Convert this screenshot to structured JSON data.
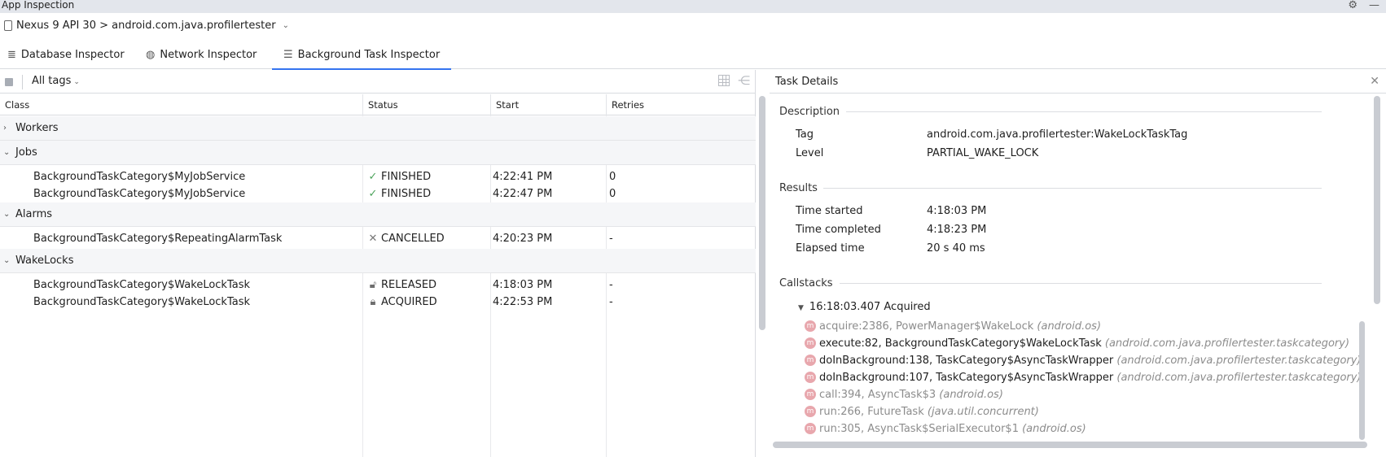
{
  "window": {
    "title": "App Inspection"
  },
  "device": {
    "label": "Nexus 9 API 30 > android.com.java.profilertester"
  },
  "tabs": [
    {
      "label": "Database Inspector",
      "icon": "database-icon"
    },
    {
      "label": "Network Inspector",
      "icon": "globe-icon"
    },
    {
      "label": "Background Task Inspector",
      "icon": "list-icon",
      "active": true
    }
  ],
  "toolbar": {
    "tag_filter": "All tags"
  },
  "table": {
    "columns": [
      "Class",
      "Status",
      "Start",
      "Retries"
    ],
    "groups": [
      {
        "name": "Workers",
        "expanded": false,
        "rows": []
      },
      {
        "name": "Jobs",
        "expanded": true,
        "rows": [
          {
            "class": "BackgroundTaskCategory$MyJobService",
            "status": "FINISHED",
            "status_icon": "check-icon",
            "start": "4:22:41 PM",
            "retries": "0"
          },
          {
            "class": "BackgroundTaskCategory$MyJobService",
            "status": "FINISHED",
            "status_icon": "check-icon",
            "start": "4:22:47 PM",
            "retries": "0"
          }
        ]
      },
      {
        "name": "Alarms",
        "expanded": true,
        "rows": [
          {
            "class": "BackgroundTaskCategory$RepeatingAlarmTask",
            "status": "CANCELLED",
            "status_icon": "x-icon",
            "start": "4:20:23 PM",
            "retries": "-"
          }
        ]
      },
      {
        "name": "WakeLocks",
        "expanded": true,
        "rows": [
          {
            "class": "BackgroundTaskCategory$WakeLockTask",
            "status": "RELEASED",
            "status_icon": "unlocked-icon",
            "start": "4:18:03 PM",
            "retries": "-"
          },
          {
            "class": "BackgroundTaskCategory$WakeLockTask",
            "status": "ACQUIRED",
            "status_icon": "lock-icon",
            "start": "4:22:53 PM",
            "retries": "-"
          }
        ]
      }
    ]
  },
  "details": {
    "title": "Task Details",
    "description": {
      "heading": "Description",
      "tag_label": "Tag",
      "tag_value": "android.com.java.profilertester:WakeLockTaskTag",
      "level_label": "Level",
      "level_value": "PARTIAL_WAKE_LOCK"
    },
    "results": {
      "heading": "Results",
      "started_label": "Time started",
      "started_value": "4:18:03 PM",
      "completed_label": "Time completed",
      "completed_value": "4:18:23 PM",
      "elapsed_label": "Elapsed time",
      "elapsed_value": "20 s 40 ms"
    },
    "callstacks": {
      "heading": "Callstacks",
      "entry": "16:18:03.407 Acquired",
      "frames": [
        {
          "text": "acquire:2386, PowerManager$WakeLock",
          "pkg": "(android.os)",
          "dim": true
        },
        {
          "text": "execute:82, BackgroundTaskCategory$WakeLockTask",
          "pkg": "(android.com.java.profilertester.taskcategory)",
          "dim": false
        },
        {
          "text": "doInBackground:138, TaskCategory$AsyncTaskWrapper",
          "pkg": "(android.com.java.profilertester.taskcategory)",
          "dim": false
        },
        {
          "text": "doInBackground:107, TaskCategory$AsyncTaskWrapper",
          "pkg": "(android.com.java.profilertester.taskcategory)",
          "dim": false
        },
        {
          "text": "call:394, AsyncTask$3",
          "pkg": "(android.os)",
          "dim": true
        },
        {
          "text": "run:266, FutureTask",
          "pkg": "(java.util.concurrent)",
          "dim": true
        },
        {
          "text": "run:305, AsyncTask$SerialExecutor$1",
          "pkg": "(android.os)",
          "dim": true
        }
      ]
    }
  }
}
